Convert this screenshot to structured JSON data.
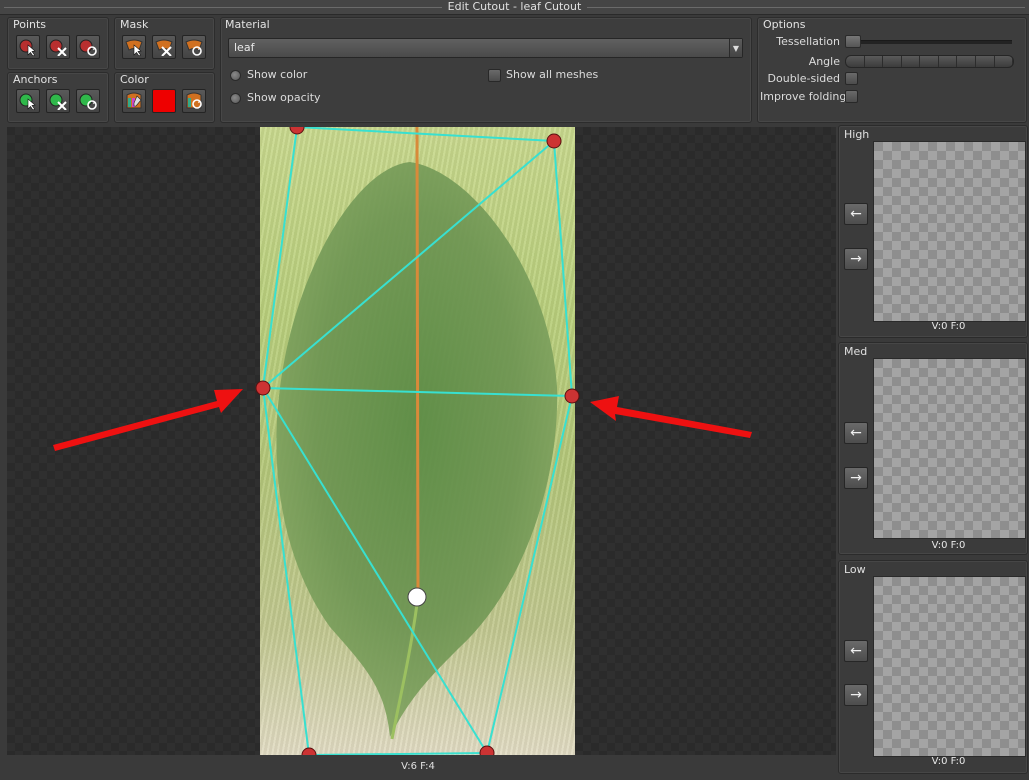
{
  "window": {
    "title": "Edit Cutout - leaf Cutout"
  },
  "groups": {
    "points": "Points",
    "mask": "Mask",
    "anchors": "Anchors",
    "color": "Color",
    "material": "Material",
    "options": "Options"
  },
  "material": {
    "selected": "leaf",
    "show_color": "Show color",
    "show_opacity": "Show opacity",
    "show_all_meshes": "Show all  meshes"
  },
  "options": {
    "tessellation": "Tessellation",
    "angle": "Angle",
    "double_sided": "Double-sided",
    "improve_folding": "Improve folding"
  },
  "status": {
    "viewport_stats": "V:6  F:4"
  },
  "lod_panels": [
    {
      "label": "High",
      "stats": "V:0  F:0"
    },
    {
      "label": "Med",
      "stats": "V:0  F:0"
    },
    {
      "label": "Low",
      "stats": "V:0  F:0"
    }
  ],
  "colors": {
    "accent_point": "#cc3333",
    "mesh_line": "#38e0d0",
    "annotation_arrow": "#ee1111",
    "color_swatch": "#ee0000"
  },
  "icons": {
    "arrow_left": "←",
    "arrow_right": "→",
    "dropdown_arrow": "▼"
  }
}
